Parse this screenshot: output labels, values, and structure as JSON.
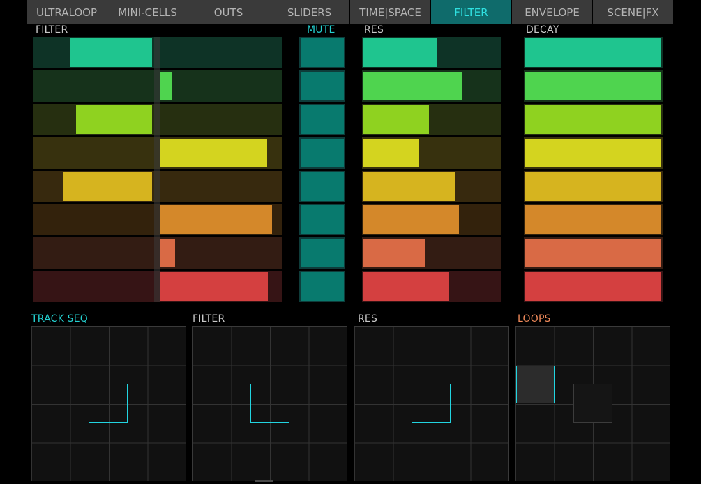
{
  "tabs": [
    {
      "label": "ULTRALOOP",
      "active": false
    },
    {
      "label": "MINI-CELLS",
      "active": false
    },
    {
      "label": "OUTS",
      "active": false
    },
    {
      "label": "SLIDERS",
      "active": false
    },
    {
      "label": "TIME|SPACE",
      "active": false
    },
    {
      "label": "FILTER",
      "active": true
    },
    {
      "label": "ENVELOPE",
      "active": false
    },
    {
      "label": "SCENE|FX",
      "active": false
    }
  ],
  "labels": {
    "filter": "FILTER",
    "mute": "MUTE",
    "res": "RES",
    "decay": "DECAY",
    "track_seq": "TRACK SEQ",
    "filter_xy": "FILTER",
    "res_xy": "RES",
    "loops": "LOOPS"
  },
  "track_colors": [
    "#1fc58f",
    "#4fd44f",
    "#8fd220",
    "#d4d41f",
    "#d6b41f",
    "#d4882a",
    "#d96a45",
    "#d44040"
  ],
  "track_backgrounds": [
    "#0e3326",
    "#16321b",
    "#262f10",
    "#37310e",
    "#37290e",
    "#33220c",
    "#331c13",
    "#361415"
  ],
  "filter_values": [
    -0.67,
    0.11,
    -0.63,
    0.87,
    -0.73,
    0.91,
    0.14,
    0.88
  ],
  "res_values": [
    0.55,
    0.73,
    0.49,
    0.42,
    0.68,
    0.71,
    0.46,
    0.64
  ],
  "decay_values": [
    1,
    1,
    1,
    1,
    1,
    1,
    1,
    1
  ],
  "mute_states": [
    false,
    false,
    false,
    false,
    false,
    false,
    false,
    false
  ]
}
